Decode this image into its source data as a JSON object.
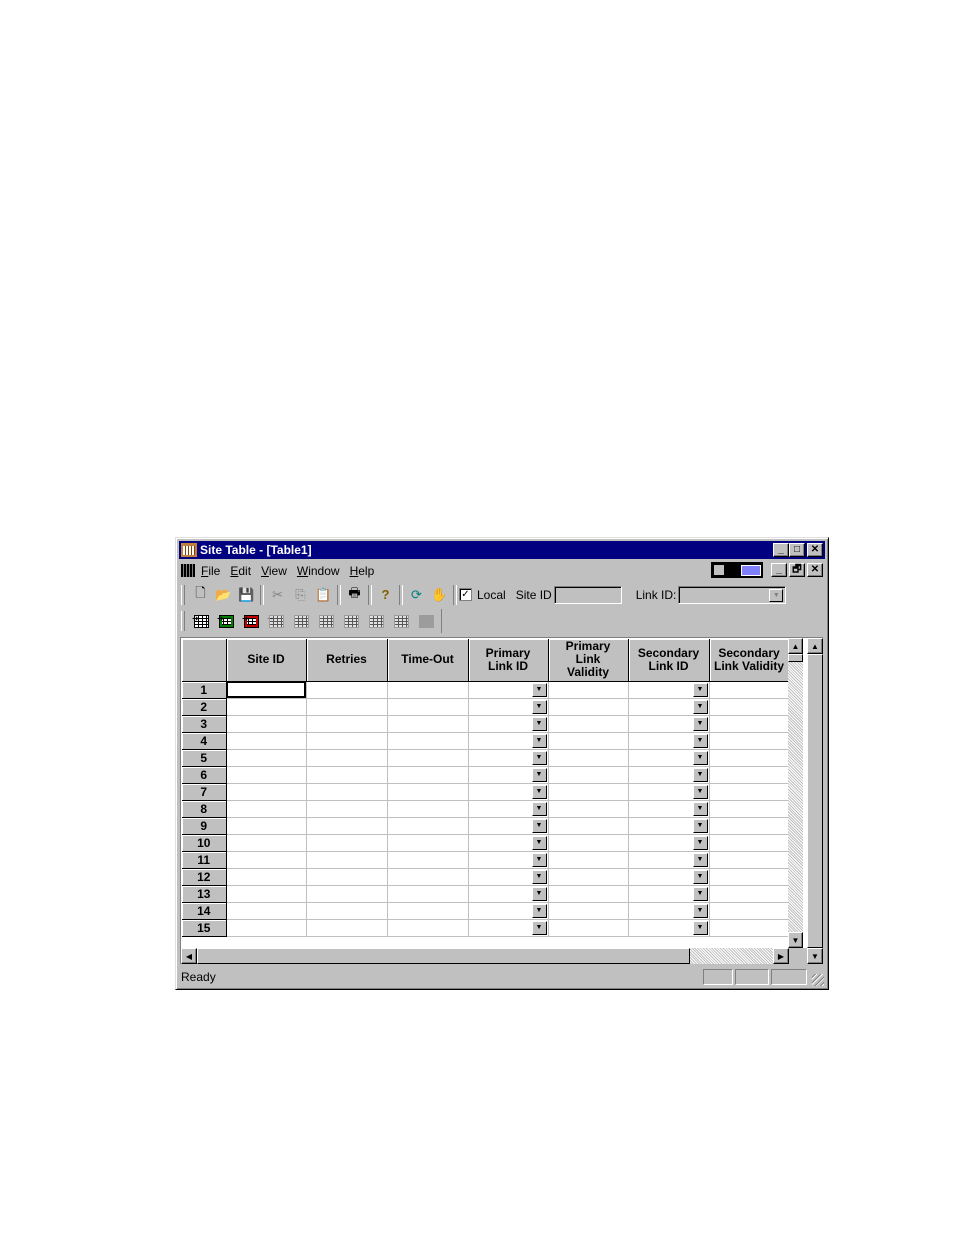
{
  "window": {
    "title": "Site Table - [Table1]",
    "controls": {
      "minimize": "_",
      "maximize": "□",
      "close": "✕",
      "restore": "🗗"
    }
  },
  "menu": {
    "items": [
      {
        "accel": "F",
        "rest": "ile"
      },
      {
        "accel": "E",
        "rest": "dit"
      },
      {
        "accel": "V",
        "rest": "iew"
      },
      {
        "accel": "W",
        "rest": "indow"
      },
      {
        "accel": "H",
        "rest": "elp"
      }
    ]
  },
  "toolbar": {
    "local_checked": "✓",
    "local_label": "Local",
    "site_id_label": "Site ID",
    "site_id_value": "",
    "link_id_label": "Link ID:",
    "link_id_value": "",
    "icons": {
      "new": "🗋",
      "open": "📂",
      "save": "💾",
      "cut": "✂",
      "copy": "⎘",
      "paste": "📋",
      "print": "🖶",
      "help": "?",
      "refresh": "⟳",
      "hand": "✋"
    }
  },
  "grid": {
    "columns": [
      {
        "line1": "Site ID",
        "line2": "",
        "line3": ""
      },
      {
        "line1": "Retries",
        "line2": "",
        "line3": ""
      },
      {
        "line1": "Time-Out",
        "line2": "",
        "line3": ""
      },
      {
        "line1": "Primary",
        "line2": "Link ID",
        "line3": ""
      },
      {
        "line1": "Primary",
        "line2": "Link",
        "line3": "Validity"
      },
      {
        "line1": "Secondary",
        "line2": "Link ID",
        "line3": ""
      },
      {
        "line1": "Secondary",
        "line2": "Link Validity",
        "line3": ""
      }
    ],
    "rows": [
      "1",
      "2",
      "3",
      "4",
      "5",
      "6",
      "7",
      "8",
      "9",
      "10",
      "11",
      "12",
      "13",
      "14",
      "15"
    ],
    "dropdown_glyph": "▼"
  },
  "scroll": {
    "up": "▲",
    "down": "▼",
    "left": "◀",
    "right": "▶"
  },
  "status": {
    "text": "Ready"
  }
}
